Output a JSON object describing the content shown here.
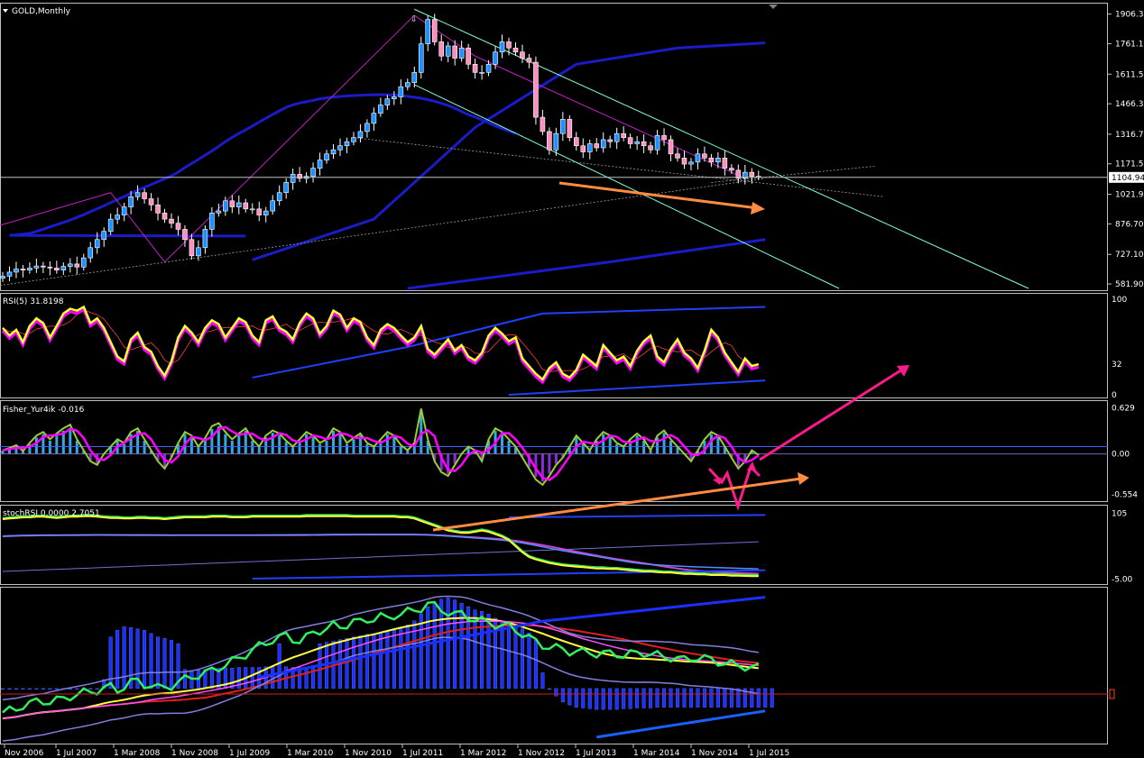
{
  "colors": {
    "background": "#000000",
    "frame": "#c0c0c0",
    "bull_candle": "#1e90ff",
    "bear_candle": "#ff8ec0",
    "channel": "#7fffd4",
    "ma_blue": "#1b1bc8",
    "rsi_main": "#ffff33",
    "rsi_shadow": "#ff00ff",
    "fisher_line": "#9acd32",
    "fisher_signal": "#ff00ff",
    "fisher_bar_up": "#33a8e0",
    "fisher_bar_down": "#8a2be2",
    "orange_arrow": "#ff8c40",
    "pink_arrow": "#ff1a8c",
    "price_line": "#c0c0c0"
  },
  "chart_data": {
    "type": "candlestick",
    "symbol_label": "GOLD,Monthly",
    "x_tick_labels": [
      "Nov 2006",
      "1 Jul 2007",
      "1 Mar 2008",
      "1 Nov 2008",
      "1 Jul 2009",
      "1 Mar 2010",
      "1 Nov 2010",
      "1 Jul 2011",
      "1 Mar 2012",
      "1 Nov 2012",
      "1 Jul 2013",
      "1 Mar 2014",
      "1 Nov 2014",
      "1 Jul 2015"
    ],
    "x_range_months": [
      0,
      137
    ],
    "price_axis": {
      "ticks": [
        "1906.30",
        "1761.10",
        "1611.50",
        "1466.30",
        "1316.70",
        "1171.50",
        "1021.90",
        "876.70",
        "727.10",
        "581.90"
      ],
      "tick_values": [
        1906.3,
        1761.1,
        1611.5,
        1466.3,
        1316.7,
        1171.5,
        1021.9,
        876.7,
        727.1,
        581.9
      ],
      "range": [
        560,
        1940
      ],
      "current_price": "1104.94",
      "current_value": 1104.94
    },
    "close": [
      620,
      640,
      655,
      650,
      660,
      670,
      665,
      660,
      650,
      668,
      680,
      665,
      710,
      760,
      800,
      840,
      900,
      920,
      960,
      1010,
      1030,
      1000,
      970,
      930,
      900,
      880,
      850,
      800,
      720,
      760,
      850,
      930,
      940,
      990,
      960,
      980,
      950,
      950,
      920,
      940,
      990,
      1030,
      1080,
      1120,
      1100,
      1110,
      1150,
      1190,
      1220,
      1240,
      1260,
      1280,
      1300,
      1330,
      1370,
      1420,
      1460,
      1490,
      1500,
      1550,
      1570,
      1620,
      1760,
      1880,
      1770,
      1700,
      1750,
      1690,
      1740,
      1660,
      1620,
      1620,
      1660,
      1720,
      1770,
      1740,
      1720,
      1690,
      1670,
      1400,
      1330,
      1240,
      1320,
      1390,
      1300,
      1260,
      1230,
      1270,
      1250,
      1290,
      1280,
      1320,
      1300,
      1270,
      1280,
      1260,
      1240,
      1310,
      1290,
      1220,
      1200,
      1170,
      1180,
      1220,
      1200,
      1180,
      1200,
      1150,
      1140,
      1100,
      1130,
      1110,
      1110
    ],
    "panels": [
      {
        "name": "RSI(5) 31.8198",
        "ticks": [
          "100",
          "32",
          "0"
        ],
        "tick_values": [
          100,
          32,
          0
        ],
        "range": [
          0,
          100
        ]
      },
      {
        "name": "Fisher_Yur4ik -0.016",
        "ticks": [
          "0.629",
          "0.00",
          "-0.554"
        ],
        "tick_values": [
          0.629,
          0,
          -0.554
        ],
        "range": [
          -0.62,
          0.66
        ]
      },
      {
        "name": "stochRSI 0.0000 2.7051",
        "ticks": [
          "105",
          "-5.00"
        ],
        "tick_values": [
          105,
          -5
        ],
        "range": [
          -10,
          110
        ]
      },
      {
        "name": "",
        "ticks": [],
        "tick_values": [],
        "range": [
          -100,
          100
        ]
      }
    ],
    "rsi_values": [
      70,
      62,
      68,
      55,
      72,
      80,
      75,
      60,
      72,
      85,
      90,
      88,
      92,
      75,
      80,
      70,
      55,
      40,
      35,
      58,
      65,
      50,
      45,
      30,
      20,
      35,
      60,
      72,
      65,
      55,
      70,
      78,
      74,
      60,
      70,
      80,
      76,
      62,
      55,
      78,
      82,
      70,
      66,
      58,
      75,
      85,
      80,
      64,
      72,
      88,
      84,
      70,
      80,
      76,
      60,
      52,
      68,
      74,
      70,
      62,
      55,
      60,
      72,
      48,
      42,
      50,
      58,
      46,
      52,
      40,
      36,
      44,
      62,
      70,
      64,
      56,
      60,
      38,
      30,
      22,
      16,
      28,
      34,
      22,
      18,
      26,
      42,
      36,
      30,
      52,
      44,
      36,
      40,
      30,
      46,
      56,
      62,
      40,
      34,
      48,
      58,
      44,
      38,
      28,
      46,
      68,
      60,
      44,
      34,
      24,
      38,
      30,
      32
    ],
    "fisher_values": [
      0.05,
      0.08,
      0.12,
      0.04,
      0.15,
      0.25,
      0.3,
      0.2,
      0.28,
      0.35,
      0.4,
      0.2,
      0.05,
      -0.1,
      -0.15,
      0.0,
      0.1,
      0.2,
      0.15,
      0.3,
      0.35,
      0.2,
      0.05,
      -0.1,
      -0.2,
      -0.05,
      0.15,
      0.3,
      0.25,
      0.1,
      0.22,
      0.38,
      0.42,
      0.3,
      0.2,
      0.28,
      0.35,
      0.2,
      0.1,
      0.25,
      0.32,
      0.28,
      0.18,
      0.1,
      0.2,
      0.3,
      0.25,
      0.15,
      0.2,
      0.35,
      0.3,
      0.15,
      0.22,
      0.28,
      0.15,
      0.1,
      0.2,
      0.3,
      0.25,
      0.12,
      0.05,
      0.15,
      0.62,
      0.2,
      -0.1,
      -0.25,
      -0.3,
      -0.15,
      0.0,
      0.1,
      0.05,
      -0.1,
      0.2,
      0.35,
      0.3,
      0.2,
      0.1,
      -0.05,
      -0.2,
      -0.35,
      -0.42,
      -0.3,
      -0.15,
      -0.05,
      0.1,
      0.25,
      0.15,
      0.05,
      0.2,
      0.3,
      0.25,
      0.15,
      0.1,
      0.2,
      0.28,
      0.2,
      0.05,
      0.25,
      0.32,
      0.2,
      0.1,
      0.0,
      -0.1,
      0.05,
      0.2,
      0.3,
      0.25,
      0.1,
      -0.05,
      -0.2,
      -0.1,
      0.05,
      -0.016
    ],
    "stoch_values": [
      95,
      96,
      97,
      98,
      98,
      99,
      99,
      98,
      97,
      98,
      99,
      99,
      100,
      100,
      99,
      98,
      97,
      97,
      96,
      96,
      97,
      97,
      96,
      96,
      95,
      96,
      97,
      98,
      98,
      98,
      98,
      99,
      99,
      99,
      98,
      98,
      98,
      99,
      99,
      99,
      99,
      99,
      99,
      99,
      99,
      100,
      100,
      100,
      100,
      100,
      100,
      100,
      99,
      99,
      99,
      99,
      99,
      99,
      99,
      98,
      98,
      96,
      92,
      88,
      84,
      80,
      76,
      74,
      72,
      72,
      74,
      76,
      74,
      70,
      66,
      60,
      50,
      40,
      32,
      28,
      25,
      22,
      20,
      18,
      17,
      16,
      15,
      14,
      13,
      13,
      12,
      12,
      11,
      10,
      9,
      8,
      8,
      7,
      6,
      6,
      5,
      4,
      4,
      3,
      3,
      2,
      2,
      2,
      1,
      1,
      0.5,
      0.2,
      0
    ],
    "macd_values": [
      -30,
      -30,
      -30,
      -30,
      -30,
      -30,
      -31,
      -31,
      -30,
      -30,
      -29,
      -28,
      -26,
      -24,
      -22,
      -20,
      10,
      20,
      25,
      24,
      22,
      20,
      15,
      10,
      8,
      5,
      0,
      -5,
      -8,
      -6,
      -5,
      -4,
      -3,
      -3,
      -3,
      -2,
      -2,
      -2,
      -2,
      -1,
      -1,
      0,
      -1,
      -2,
      -2,
      -2,
      -2,
      0,
      2,
      4,
      6,
      8,
      10,
      12,
      14,
      15,
      16,
      18,
      20,
      22,
      28,
      34,
      44,
      55,
      60,
      66,
      68,
      65,
      60,
      55,
      50,
      48,
      44,
      38,
      34,
      30,
      26,
      22,
      16,
      5,
      -10,
      -25,
      -40,
      -48,
      -52,
      -55,
      -56,
      -57,
      -58,
      -58,
      -58,
      -58,
      -57,
      -57,
      -56,
      -56,
      -56,
      -55,
      -55,
      -55,
      -55,
      -55,
      -55,
      -55,
      -55,
      -55,
      -55,
      -55,
      -55,
      -55,
      -55,
      -55,
      -55,
      -55,
      -55
    ],
    "macd_line_values": [
      -70,
      -68,
      -66,
      -60,
      -58,
      -56,
      -55,
      -55,
      -54,
      -52,
      -48,
      -46,
      -44,
      -42,
      -40,
      -38,
      -36,
      -40,
      -35,
      -30,
      -28,
      -32,
      -34,
      -38,
      -36,
      -34,
      -30,
      -26,
      -22,
      -20,
      -18,
      -14,
      -10,
      -6,
      -2,
      2,
      8,
      14,
      18,
      22,
      28,
      30,
      32,
      28,
      26,
      30,
      36,
      40,
      42,
      46,
      44,
      48,
      52,
      50,
      54,
      56,
      58,
      55,
      60,
      62,
      64,
      66,
      70,
      75,
      72,
      68,
      64,
      60,
      62,
      58,
      54,
      52,
      50,
      48,
      46,
      44,
      40,
      36,
      30,
      24,
      20,
      18,
      16,
      14,
      12,
      12,
      10,
      10,
      9,
      9,
      8,
      8,
      7,
      8,
      9,
      10,
      8,
      6,
      4,
      4,
      2,
      0,
      2,
      4,
      2,
      0,
      -2,
      -4,
      -6,
      -8,
      -8,
      -10,
      -10
    ]
  },
  "annotations": {
    "down_arrow_marker": "⇩"
  }
}
